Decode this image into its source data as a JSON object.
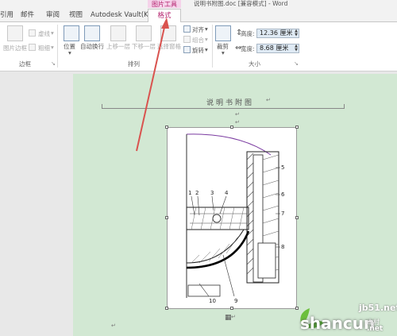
{
  "window": {
    "title": "说明书附图.doc [兼容模式] - Word",
    "context_group": "图片工具"
  },
  "tabs": {
    "items": [
      "引用",
      "邮件",
      "审阅",
      "视图",
      "Autodesk Vault(K)"
    ],
    "active": "格式"
  },
  "ribbon": {
    "border_group": {
      "picture_border": "图片边框",
      "dash": "虚线",
      "weight": "粗细",
      "label": "边框"
    },
    "arrange_group": {
      "position": "位置",
      "wrap_text": "自动换行",
      "bring_forward": "上移一层",
      "send_backward": "下移一层",
      "selection_pane": "选择窗格",
      "align": "对齐",
      "group": "组合",
      "rotate": "旋转",
      "label": "排列"
    },
    "size_group": {
      "crop": "裁剪",
      "height_label": "高度:",
      "height_value": "12.36 厘米",
      "width_label": "宽度:",
      "width_value": "8.68 厘米",
      "label": "大小"
    }
  },
  "document": {
    "caption": "说明书附图",
    "paragraph_mark": "↵",
    "figure_labels": [
      "1",
      "2",
      "3",
      "4",
      "5",
      "6",
      "7",
      "8",
      "9",
      "10"
    ]
  },
  "watermark": {
    "site": "jb51.net",
    "brand": "shancun",
    "brand_cn": "山村",
    "brand_net": ".net"
  },
  "colors": {
    "accent": "#b4236e",
    "page_green": "#d2e8d3",
    "arrow": "#d9534f"
  }
}
